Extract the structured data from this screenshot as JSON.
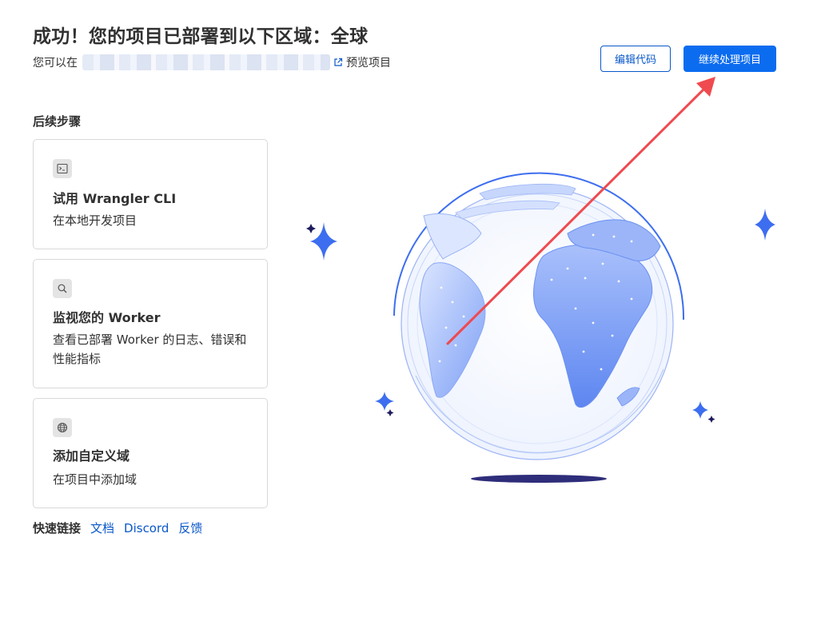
{
  "header": {
    "title": "成功！您的项目已部署到以下区域：全球",
    "subtitle_prefix": "您可以在",
    "preview_label": "预览项目"
  },
  "actions": {
    "edit_code": "编辑代码",
    "continue": "继续处理项目"
  },
  "next_steps": {
    "title": "后续步骤",
    "cards": [
      {
        "icon": "terminal-icon",
        "title": "试用 Wrangler CLI",
        "desc": "在本地开发项目"
      },
      {
        "icon": "search-icon",
        "title": "监视您的 Worker",
        "desc": "查看已部署 Worker 的日志、错误和性能指标"
      },
      {
        "icon": "globe-icon",
        "title": "添加自定义域",
        "desc": "在项目中添加域"
      }
    ]
  },
  "quick_links": {
    "label": "快速链接",
    "links": [
      "文档",
      "Discord",
      "反馈"
    ]
  },
  "colors": {
    "primary": "#0b6cf0",
    "link": "#0a58c9",
    "annotation_arrow": "#ef4a4f",
    "globe_blue": "#3d6ef0"
  }
}
